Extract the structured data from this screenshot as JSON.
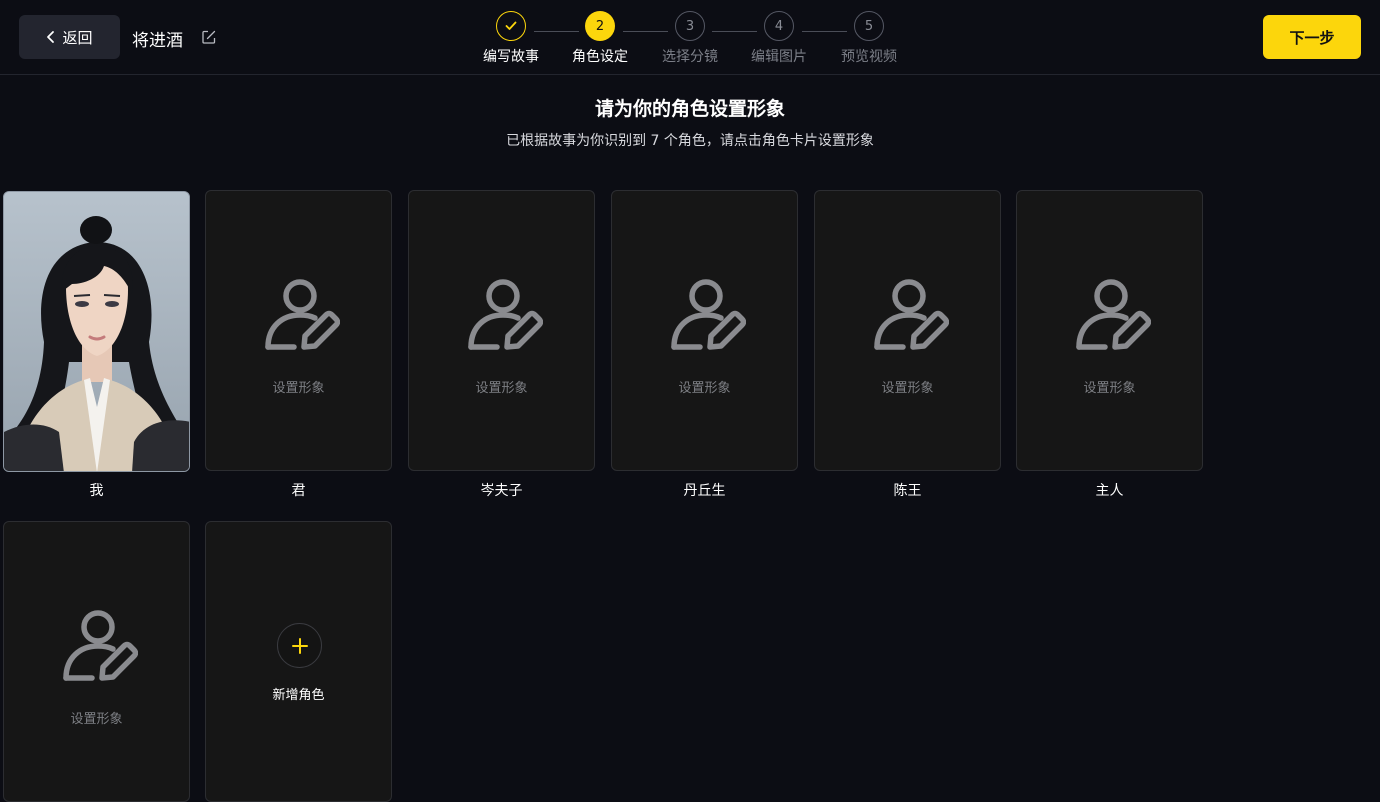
{
  "header": {
    "back_label": "返回",
    "project_title": "将进酒",
    "next_label": "下一步",
    "steps": [
      {
        "number": "1",
        "label": "编写故事",
        "state": "done"
      },
      {
        "number": "2",
        "label": "角色设定",
        "state": "active"
      },
      {
        "number": "3",
        "label": "选择分镜",
        "state": "pending"
      },
      {
        "number": "4",
        "label": "编辑图片",
        "state": "pending"
      },
      {
        "number": "5",
        "label": "预览视频",
        "state": "pending"
      }
    ]
  },
  "main": {
    "heading": "请为你的角色设置形象",
    "subheading": "已根据故事为你识别到 7 个角色，请点击角色卡片设置形象",
    "set_image_label": "设置形象",
    "add_role_label": "新增角色",
    "characters": [
      {
        "name": "我",
        "has_image": true
      },
      {
        "name": "君",
        "has_image": false
      },
      {
        "name": "岑夫子",
        "has_image": false
      },
      {
        "name": "丹丘生",
        "has_image": false
      },
      {
        "name": "陈王",
        "has_image": false
      },
      {
        "name": "主人",
        "has_image": false
      },
      {
        "name": "",
        "has_image": false
      }
    ]
  },
  "colors": {
    "background": "#0c0d14",
    "accent": "#fcd60c",
    "card": "#161616",
    "muted_text": "#7d7f84"
  },
  "icons": {
    "back": "chevron-left-icon",
    "edit": "edit-icon",
    "step_done": "check-icon",
    "placeholder": "user-edit-icon",
    "add": "plus-icon"
  }
}
